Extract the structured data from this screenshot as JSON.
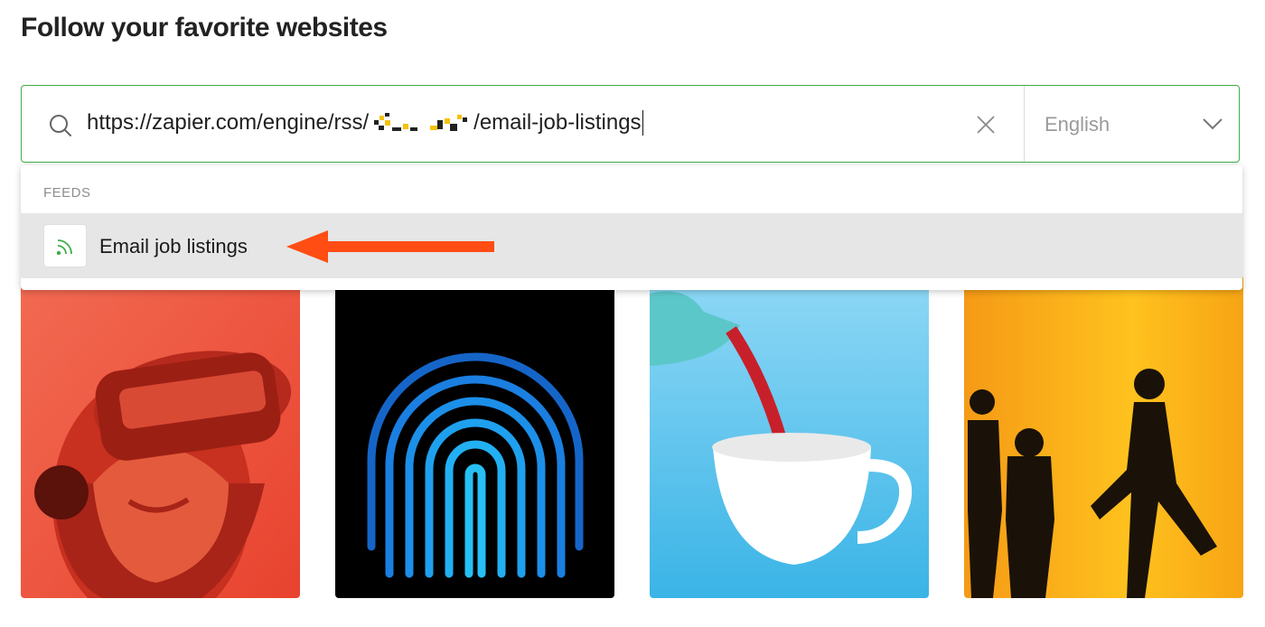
{
  "heading": "Follow your favorite websites",
  "search": {
    "icon": "search-icon",
    "url_prefix": "https://zapier.com/engine/rss/",
    "url_suffix": "/email-job-listings",
    "clear_icon": "close-icon",
    "language": "English",
    "language_icon": "chevron-down-icon",
    "border_color": "#3fae49"
  },
  "dropdown": {
    "section_label": "FEEDS",
    "options": [
      {
        "icon": "rss-icon",
        "label": "Email job listings",
        "highlight_color": "#e6e6e6"
      }
    ],
    "annotation_arrow_color": "#ff4d14"
  },
  "cards": [
    {
      "image": "vr-headset-photo",
      "accent": "#f25a4a"
    },
    {
      "image": "fingerprint-photo",
      "accent": "#1e88e5"
    },
    {
      "image": "teapot-cup-photo",
      "accent": "#4cc3ee"
    },
    {
      "image": "walking-silhouettes-photo",
      "accent": "#f7a11a"
    }
  ]
}
